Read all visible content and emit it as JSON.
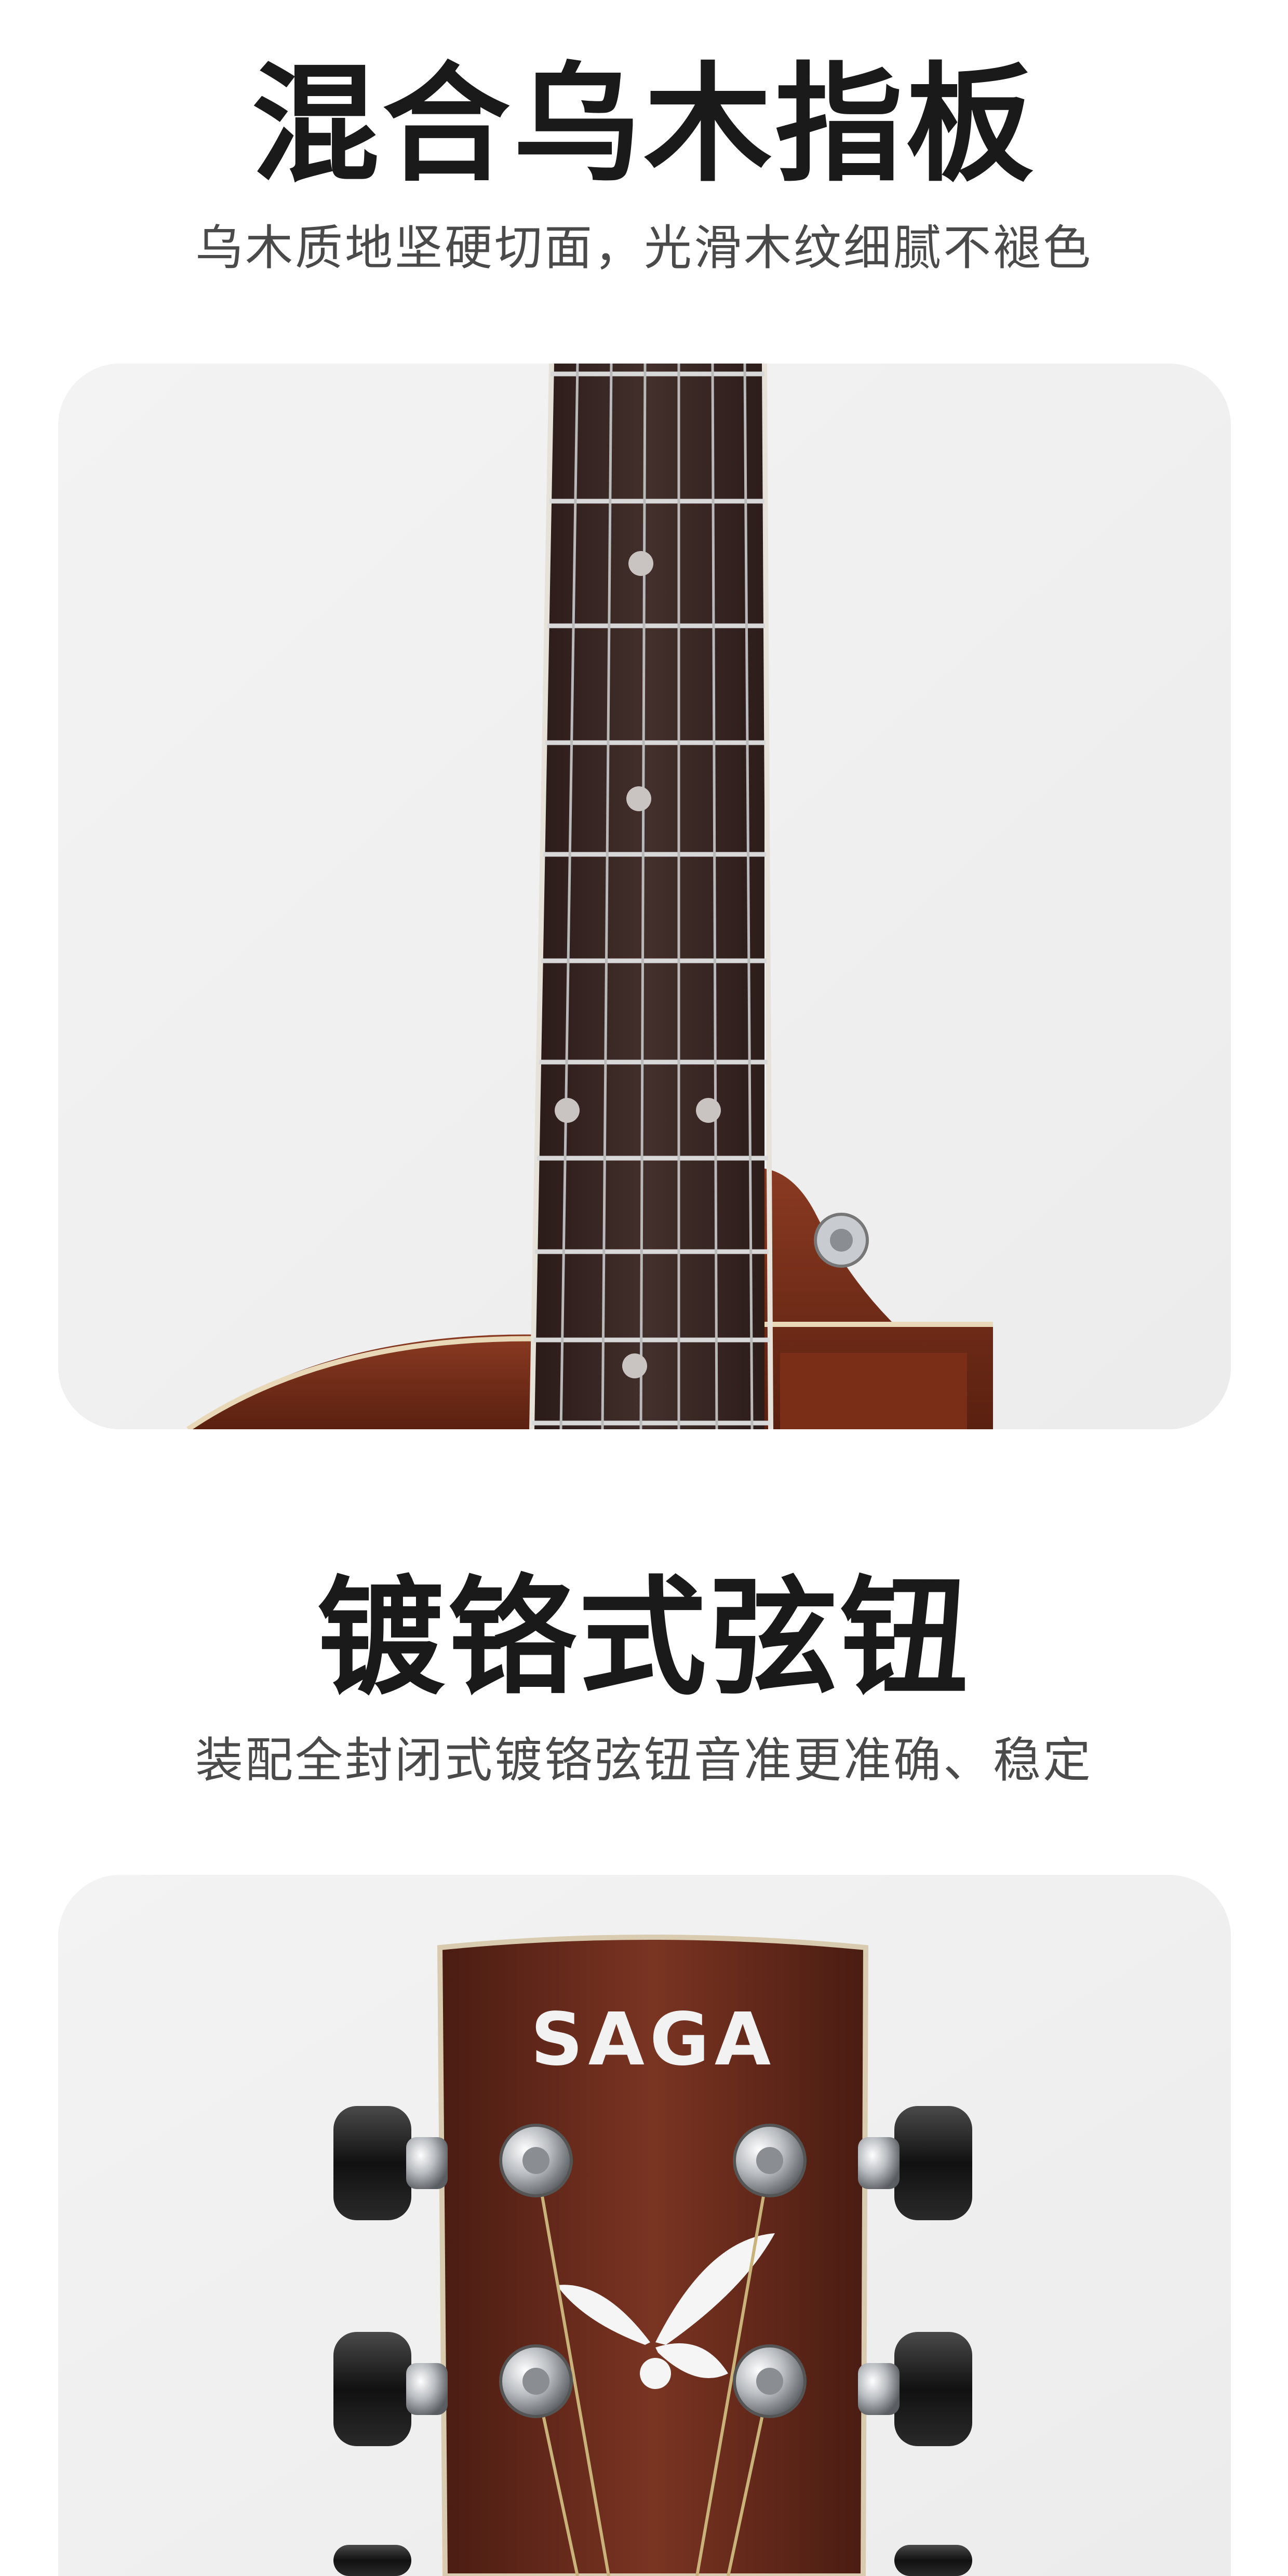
{
  "section1": {
    "title": "混合乌木指板",
    "subtitle": "乌木质地坚硬切面，光滑木纹细腻不褪色"
  },
  "section2": {
    "title": "镀铬式弦钮",
    "subtitle": "装配全封闭式镀铬弦钮音准更准确、稳定",
    "headstock_logo": "SAGA"
  },
  "colors": {
    "card_bg": "#f0f0f0",
    "fretboard": "#3a2522",
    "wood": "#6e2a18",
    "chrome": "#c8ccd0",
    "title_text": "#1a1a1a",
    "subtitle_text": "#4a4a4a"
  }
}
